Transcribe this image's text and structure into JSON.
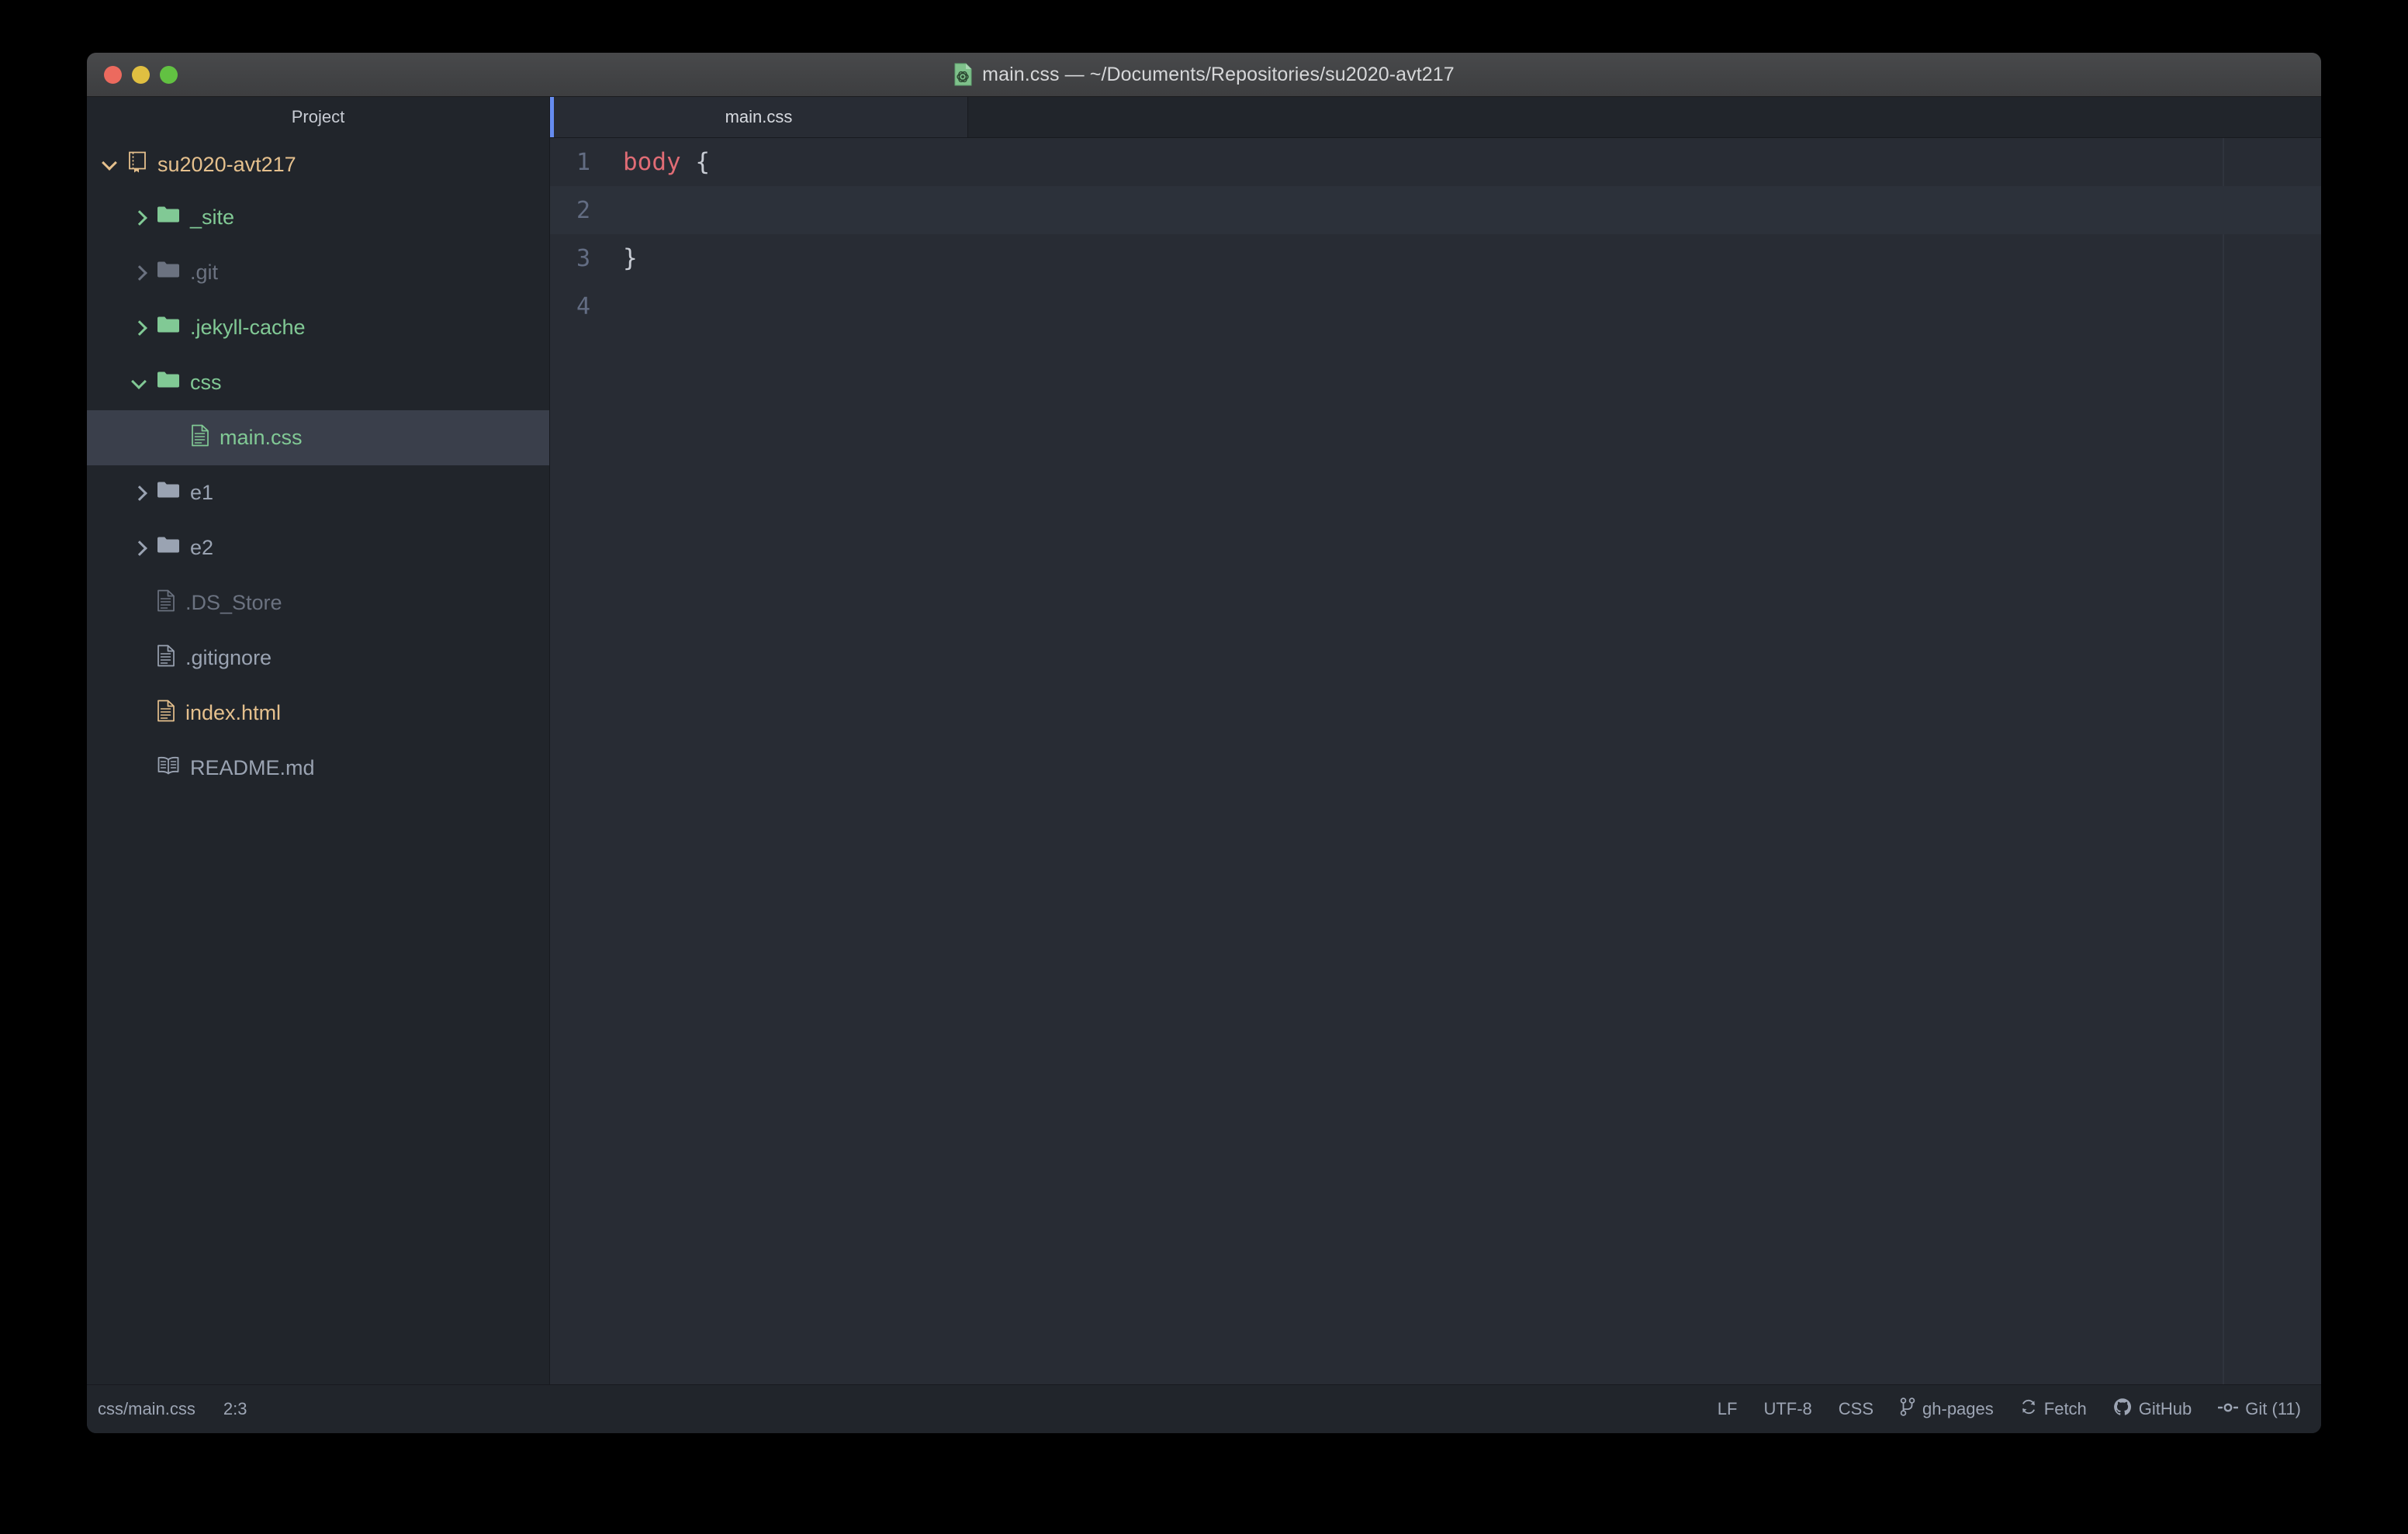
{
  "window": {
    "title": "main.css — ~/Documents/Repositories/su2020-avt217",
    "app_icon": "atom-document-icon",
    "traffic_lights": {
      "close_label": "close",
      "minimize_label": "minimize",
      "zoom_label": "zoom",
      "close_color": "#ec6a5e",
      "minimize_color": "#e0bf41",
      "zoom_color": "#62c142"
    }
  },
  "sidebar": {
    "header": "Project",
    "tree": [
      {
        "label": "su2020-avt217",
        "icon": "repo-icon",
        "indent": 0,
        "arrow": "down",
        "color": "#e5c08d",
        "selected": false,
        "type": "repo-root"
      },
      {
        "label": "_site",
        "icon": "folder-icon",
        "indent": 1,
        "arrow": "right",
        "color": "#81c995",
        "selected": false,
        "type": "folder"
      },
      {
        "label": ".git",
        "icon": "folder-icon",
        "indent": 1,
        "arrow": "right",
        "color": "#6b7280",
        "selected": false,
        "type": "folder"
      },
      {
        "label": ".jekyll-cache",
        "icon": "folder-icon",
        "indent": 1,
        "arrow": "right",
        "color": "#81c995",
        "selected": false,
        "type": "folder"
      },
      {
        "label": "css",
        "icon": "folder-icon",
        "indent": 1,
        "arrow": "down",
        "color": "#81c995",
        "selected": false,
        "type": "folder"
      },
      {
        "label": "main.css",
        "icon": "file-icon",
        "indent": 2,
        "arrow": "none",
        "color": "#81c995",
        "selected": true,
        "type": "file"
      },
      {
        "label": "e1",
        "icon": "folder-icon",
        "indent": 1,
        "arrow": "right",
        "color": "#9aa3b2",
        "selected": false,
        "type": "folder"
      },
      {
        "label": "e2",
        "icon": "folder-icon",
        "indent": 1,
        "arrow": "right",
        "color": "#9aa3b2",
        "selected": false,
        "type": "folder"
      },
      {
        "label": ".DS_Store",
        "icon": "file-icon",
        "indent": 1,
        "arrow": "none",
        "color": "#6b7280",
        "selected": false,
        "type": "file"
      },
      {
        "label": ".gitignore",
        "icon": "file-icon",
        "indent": 1,
        "arrow": "none",
        "color": "#9aa3b2",
        "selected": false,
        "type": "file"
      },
      {
        "label": "index.html",
        "icon": "file-icon",
        "indent": 1,
        "arrow": "none",
        "color": "#e5c08d",
        "selected": false,
        "type": "file"
      },
      {
        "label": "README.md",
        "icon": "book-icon",
        "indent": 1,
        "arrow": "none",
        "color": "#9aa3b2",
        "selected": false,
        "type": "file"
      }
    ]
  },
  "tabs": {
    "active_accent_color": "#668cf0",
    "items": [
      {
        "label": "main.css",
        "active": true
      }
    ]
  },
  "editor": {
    "language": "CSS",
    "cursor_line_index": 1,
    "lines": [
      {
        "number": "1",
        "selector": "body",
        "rest": " {"
      },
      {
        "number": "2",
        "selector": "",
        "rest": ""
      },
      {
        "number": "3",
        "selector": "",
        "rest": "}"
      },
      {
        "number": "4",
        "selector": "",
        "rest": ""
      }
    ]
  },
  "statusbar": {
    "file_path": "css/main.css",
    "cursor_position": "2:3",
    "line_ending": "LF",
    "encoding": "UTF-8",
    "grammar": "CSS",
    "branch": "gh-pages",
    "fetch": "Fetch",
    "github": "GitHub",
    "git": "Git (11)"
  }
}
